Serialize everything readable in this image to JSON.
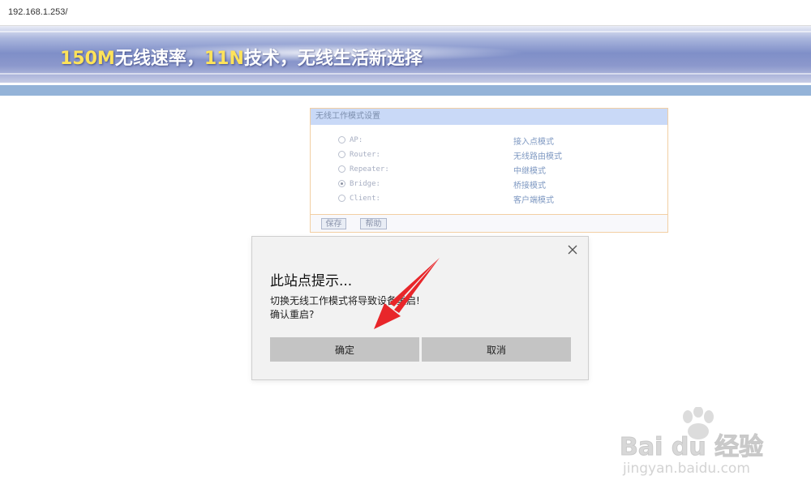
{
  "address_bar": {
    "url": "192.168.1.253/"
  },
  "banner": {
    "parts": [
      "150M",
      "无线速率，",
      "11N",
      "技术，无线生活新选择"
    ]
  },
  "panel": {
    "title": "无线工作模式设置",
    "modes": [
      {
        "label": "AP:",
        "desc": "接入点模式",
        "checked": false
      },
      {
        "label": "Router:",
        "desc": "无线路由模式",
        "checked": false
      },
      {
        "label": "Repeater:",
        "desc": "中继模式",
        "checked": false
      },
      {
        "label": "Bridge:",
        "desc": "桥接模式",
        "checked": true
      },
      {
        "label": "Client:",
        "desc": "客户端模式",
        "checked": false
      }
    ],
    "save_label": "保存",
    "help_label": "帮助"
  },
  "dialog": {
    "title": "此站点提示...",
    "message_line1": "切换无线工作模式将导致设备重启!",
    "message_line2": "确认重启?",
    "ok_label": "确定",
    "cancel_label": "取消",
    "close_icon": "close-icon"
  },
  "watermark": {
    "logo": "Bai du 经验",
    "url": "jingyan.baidu.com"
  },
  "colors": {
    "annotation_arrow": "#e8262a",
    "panel_header": "#c9d9f7",
    "panel_border": "#f2cfa3",
    "banner_accent": "#ffe35a",
    "blue_band": "#94b3d8"
  }
}
